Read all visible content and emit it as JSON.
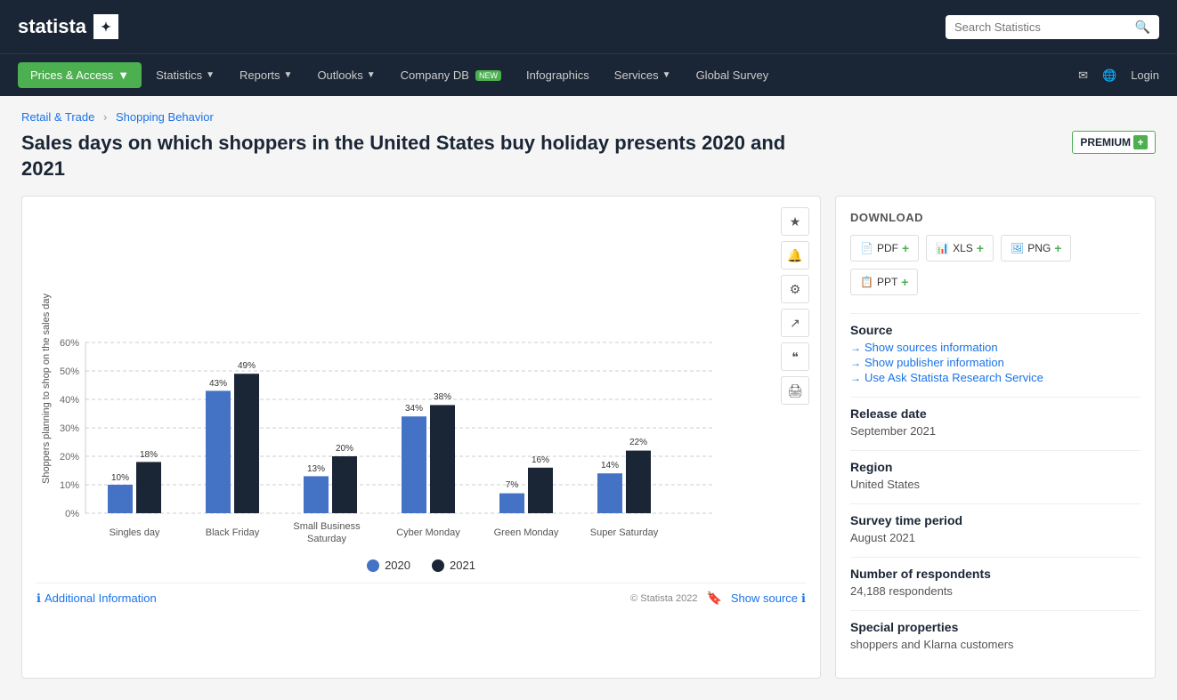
{
  "header": {
    "logo_text": "statista",
    "search_placeholder": "Search Statistics"
  },
  "nav": {
    "prices_access": "Prices & Access",
    "statistics": "Statistics",
    "reports": "Reports",
    "outlooks": "Outlooks",
    "company_db": "Company DB",
    "company_db_badge": "NEW",
    "infographics": "Infographics",
    "services": "Services",
    "global_survey": "Global Survey",
    "login": "Login"
  },
  "breadcrumb": {
    "retail": "Retail & Trade",
    "separator": "›",
    "shopping": "Shopping Behavior"
  },
  "page": {
    "title": "Sales days on which shoppers in the United States buy holiday presents 2020 and 2021",
    "premium_label": "PREMIUM",
    "premium_plus": "+"
  },
  "chart": {
    "y_axis_label": "Shoppers planning to shop on the sales day",
    "y_ticks": [
      "0%",
      "10%",
      "20%",
      "30%",
      "40%",
      "50%",
      "60%"
    ],
    "bars": [
      {
        "category": "Singles day",
        "val2020": 10,
        "val2021": 18,
        "label2020": "10%",
        "label2021": "18%"
      },
      {
        "category": "Black Friday",
        "val2020": 43,
        "val2021": 49,
        "label2020": "43%",
        "label2021": "49%"
      },
      {
        "category": "Small Business Saturday",
        "val2020": 13,
        "val2021": 20,
        "label2020": "13%",
        "label2021": "20%"
      },
      {
        "category": "Cyber Monday",
        "val2020": 34,
        "val2021": 38,
        "label2020": "34%",
        "label2021": "38%"
      },
      {
        "category": "Green Monday",
        "val2020": 7,
        "val2021": 16,
        "label2020": "7%",
        "label2021": "16%"
      },
      {
        "category": "Super Saturday",
        "val2020": 14,
        "val2021": 22,
        "label2020": "14%",
        "label2021": "22%"
      }
    ],
    "legend_2020": "2020",
    "legend_2021": "2021",
    "copyright": "© Statista 2022",
    "show_source": "Show source",
    "additional_info": "Additional Information"
  },
  "download": {
    "title": "DOWNLOAD",
    "pdf": "PDF",
    "xls": "XLS",
    "png": "PNG",
    "ppt": "PPT",
    "plus": "+"
  },
  "source_section": {
    "label": "Source",
    "show_sources": "Show sources information",
    "show_publisher": "Show publisher information",
    "ask_statista": "Use Ask Statista Research Service"
  },
  "release_date": {
    "label": "Release date",
    "value": "September 2021"
  },
  "region": {
    "label": "Region",
    "value": "United States"
  },
  "survey_period": {
    "label": "Survey time period",
    "value": "August 2021"
  },
  "respondents": {
    "label": "Number of respondents",
    "value": "24,188 respondents"
  },
  "special_properties": {
    "label": "Special properties",
    "value": "shoppers and Klarna customers"
  },
  "icons": {
    "star": "★",
    "bell": "🔔",
    "gear": "⚙",
    "share": "↗",
    "quote": "❝",
    "print": "🖨",
    "search": "🔍",
    "mail": "✉",
    "globe": "🌐",
    "info": "ℹ",
    "arrow_right": "→",
    "bookmark": "🔖"
  }
}
